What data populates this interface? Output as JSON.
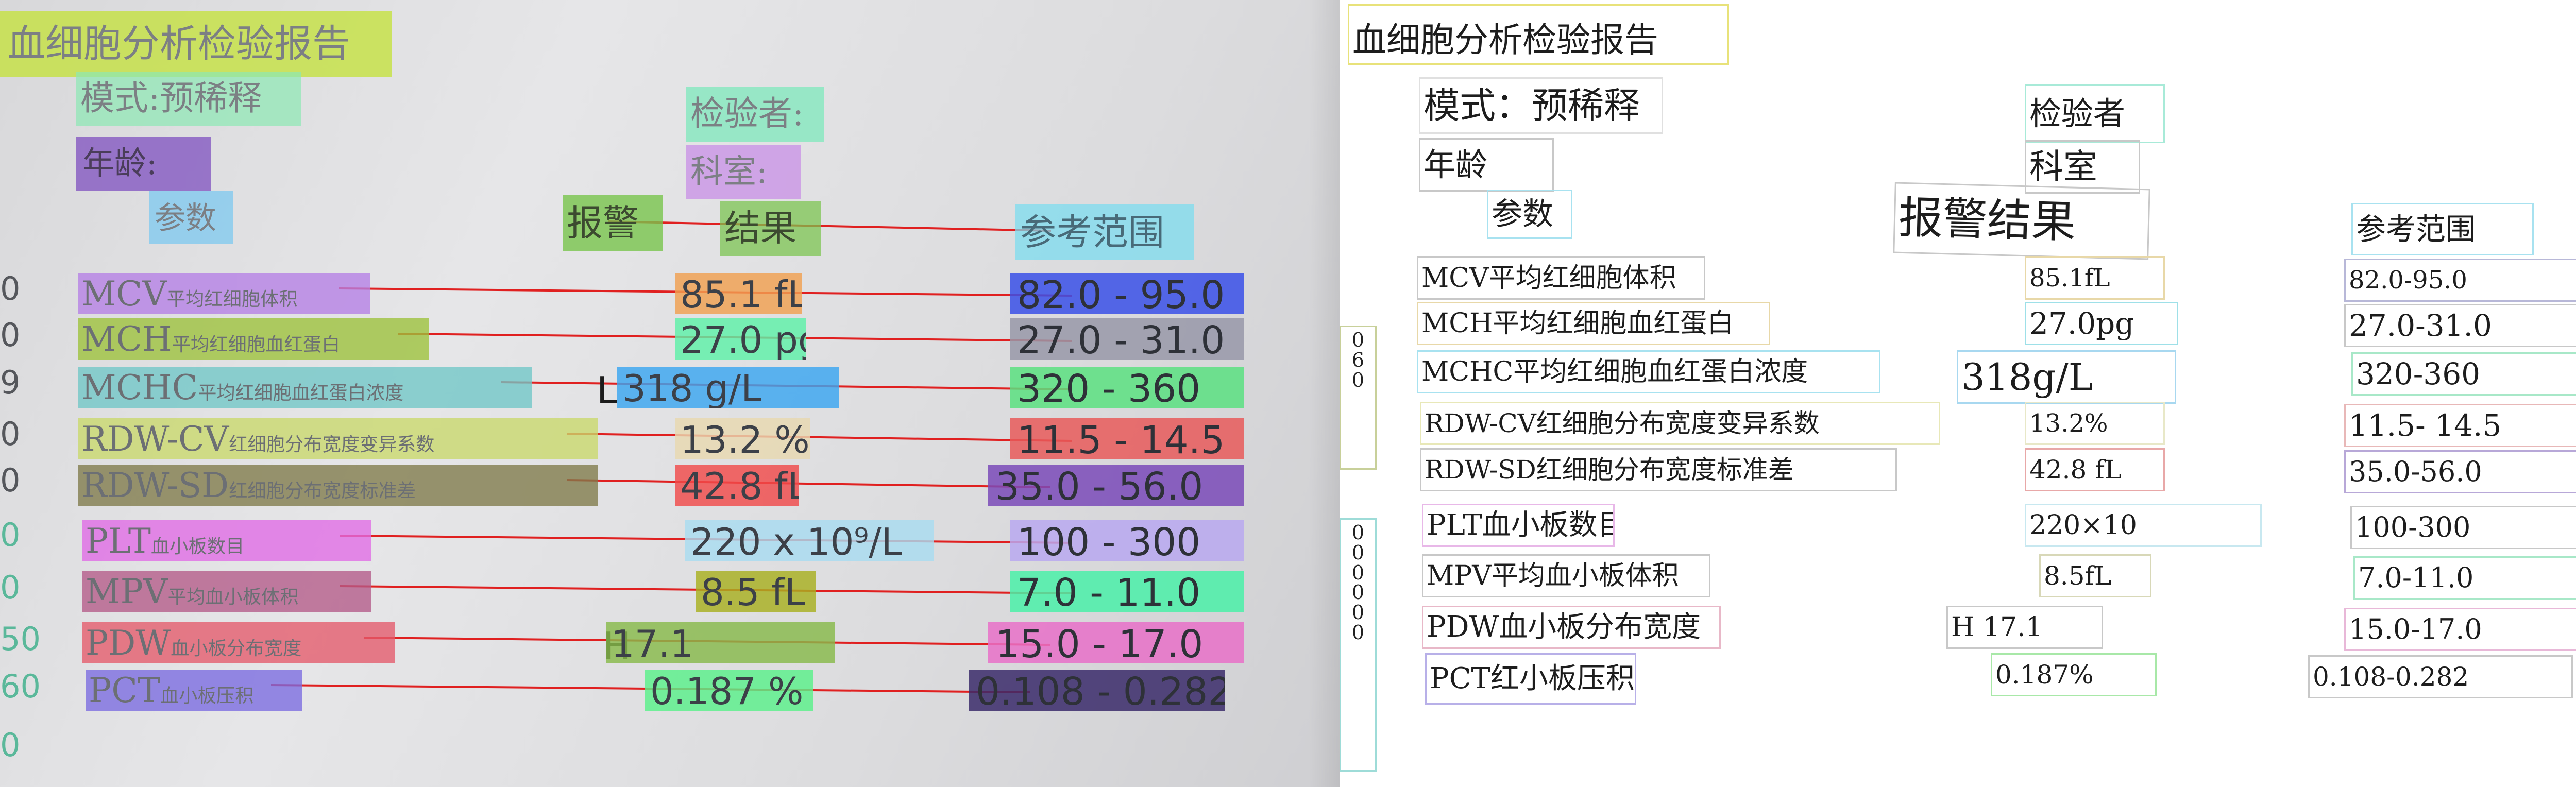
{
  "report": {
    "title": "血细胞分析检验报告",
    "mode": "模式：预稀释",
    "age": "年龄",
    "inspector": "检验者",
    "department": "科室",
    "header_param": "参数",
    "header_result": "报警结果",
    "header_range": "参考范围"
  },
  "photo": {
    "title": "血细胞分析检验报告",
    "mode": "模式:预稀释",
    "age": "年龄:",
    "inspector": "检验者:",
    "department": "科室:",
    "header_param": "参数",
    "header_alarm": "报警",
    "header_result": "结果",
    "header_range": "参考范围",
    "lead_digits": [
      "0",
      "0",
      "9",
      "0",
      "0",
      "0",
      "0",
      "50",
      "60",
      "0"
    ],
    "rows": [
      {
        "code": "MCV",
        "cn": "平均红细胞体积",
        "alarm": "",
        "result": "85.1 fL",
        "range": "82.0 - 95.0",
        "color": "#b57fe6"
      },
      {
        "code": "MCH",
        "cn": "平均红细胞血红蛋白",
        "alarm": "",
        "result": "27.0 pg",
        "range": "27.0 - 31.0",
        "color": "#9cc23a"
      },
      {
        "code": "MCHC",
        "cn": "平均红细胞血红蛋白浓度",
        "alarm": "L",
        "result": "318 g/L",
        "range": "320 - 360",
        "color": "#6fc6c6"
      },
      {
        "code": "RDW-CV",
        "cn": "红细胞分布宽度变异系数",
        "alarm": "",
        "result": "13.2 %",
        "range": "11.5 - 14.5",
        "color": "#c9d86a"
      },
      {
        "code": "RDW-SD",
        "cn": "红细胞分布宽度标准差",
        "alarm": "",
        "result": "42.8 fL",
        "range": "35.0 - 56.0",
        "color": "#7f7a49"
      },
      {
        "code": "PLT",
        "cn": "血小板数目",
        "alarm": "",
        "result": "220 x 10⁹/L",
        "range": "100 - 300",
        "color": "#e06ae6"
      },
      {
        "code": "MPV",
        "cn": "平均血小板体积",
        "alarm": "",
        "result": "8.5 fL",
        "range": "7.0 - 11.0",
        "color": "#b35a88"
      },
      {
        "code": "PDW",
        "cn": "血小板分布宽度",
        "alarm": "H",
        "result": "17.1",
        "range": "15.0 - 17.0",
        "color": "#e45a6a"
      },
      {
        "code": "PCT",
        "cn": "血小板压积",
        "alarm": "",
        "result": "0.187 %",
        "range": "0.108 - 0.282",
        "color": "#7a6ae0"
      }
    ]
  },
  "ocr": {
    "params": [
      "MCV平均红细胞体积",
      "MCH平均红细胞血红蛋白",
      "MCHC平均红细胞血红蛋白浓度",
      "RDW-CV红细胞分布宽度变异系数",
      "RDW-SD红细胞分布宽度标准差",
      "PLT血小板数目",
      "MPV平均血小板体积",
      "PDW血小板分布宽度",
      "PCT红小板压积"
    ],
    "results": [
      "85.1fL",
      "27.0pg",
      "318g/L",
      "13.2%",
      "42.8 fL",
      "220×10",
      "8.5fL",
      "H 17.1",
      "0.187%"
    ],
    "ranges": [
      "82.0-95.0",
      "27.0-31.0",
      "320-360",
      "11.5- 14.5",
      "35.0-56.0",
      "100-300",
      "7.0-11.0",
      "15.0-17.0",
      "0.108-0.282"
    ],
    "left_col_1": "0\n6\n0",
    "left_col_2": "0\n0\n0\n0\n0\n0"
  }
}
